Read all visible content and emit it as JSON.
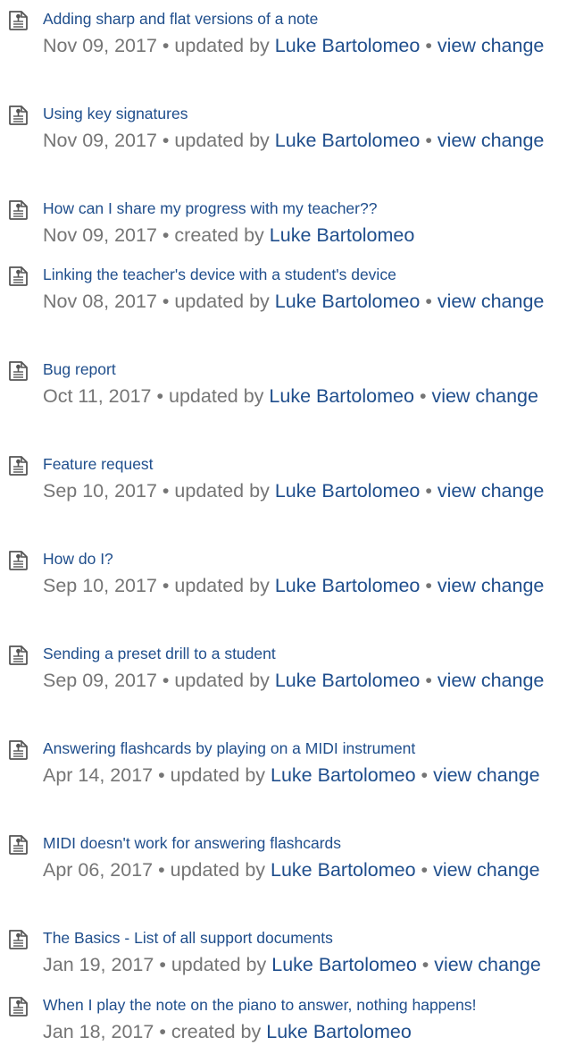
{
  "colors": {
    "link": "#1f4e8c",
    "meta": "#757575",
    "icon_stroke": "#555555"
  },
  "items": [
    {
      "title": "Adding sharp and flat versions of a note",
      "date": "Nov 09, 2017",
      "action": "updated by",
      "user": "Luke Bartolomeo",
      "change": "view change",
      "icon": "document-icon"
    },
    {
      "title": "Using key signatures",
      "date": "Nov 09, 2017",
      "action": "updated by",
      "user": "Luke Bartolomeo",
      "change": "view change",
      "icon": "document-icon"
    },
    {
      "title": "How can I share my progress with my teacher??",
      "date": "Nov 09, 2017",
      "action": "created by",
      "user": "Luke Bartolomeo",
      "change": "",
      "icon": "document-icon"
    },
    {
      "title": "Linking the teacher's device with a student's device",
      "date": "Nov 08, 2017",
      "action": "updated by",
      "user": "Luke Bartolomeo",
      "change": "view change",
      "icon": "document-icon"
    },
    {
      "title": "Bug report",
      "date": "Oct 11, 2017",
      "action": "updated by",
      "user": "Luke Bartolomeo",
      "change": "view change",
      "icon": "document-icon"
    },
    {
      "title": "Feature request",
      "date": "Sep 10, 2017",
      "action": "updated by",
      "user": "Luke Bartolomeo",
      "change": "view change",
      "icon": "document-icon"
    },
    {
      "title": "How do I?",
      "date": "Sep 10, 2017",
      "action": "updated by",
      "user": "Luke Bartolomeo",
      "change": "view change",
      "icon": "document-icon"
    },
    {
      "title": "Sending a preset drill to a student",
      "date": "Sep 09, 2017",
      "action": "updated by",
      "user": "Luke Bartolomeo",
      "change": "view change",
      "icon": "document-icon"
    },
    {
      "title": "Answering flashcards by playing on a MIDI instrument",
      "date": "Apr 14, 2017",
      "action": "updated by",
      "user": "Luke Bartolomeo",
      "change": "view change",
      "icon": "document-icon"
    },
    {
      "title": "MIDI doesn't work for answering flashcards",
      "date": "Apr 06, 2017",
      "action": "updated by",
      "user": "Luke Bartolomeo",
      "change": "view change",
      "icon": "document-icon"
    },
    {
      "title": "The Basics - List of all support documents",
      "date": "Jan 19, 2017",
      "action": "updated by",
      "user": "Luke Bartolomeo",
      "change": "view change",
      "icon": "document-icon"
    },
    {
      "title": "When I play the note on the piano to answer, nothing happens!",
      "date": "Jan 18, 2017",
      "action": "created by",
      "user": "Luke Bartolomeo",
      "change": "",
      "icon": "document-icon"
    }
  ]
}
